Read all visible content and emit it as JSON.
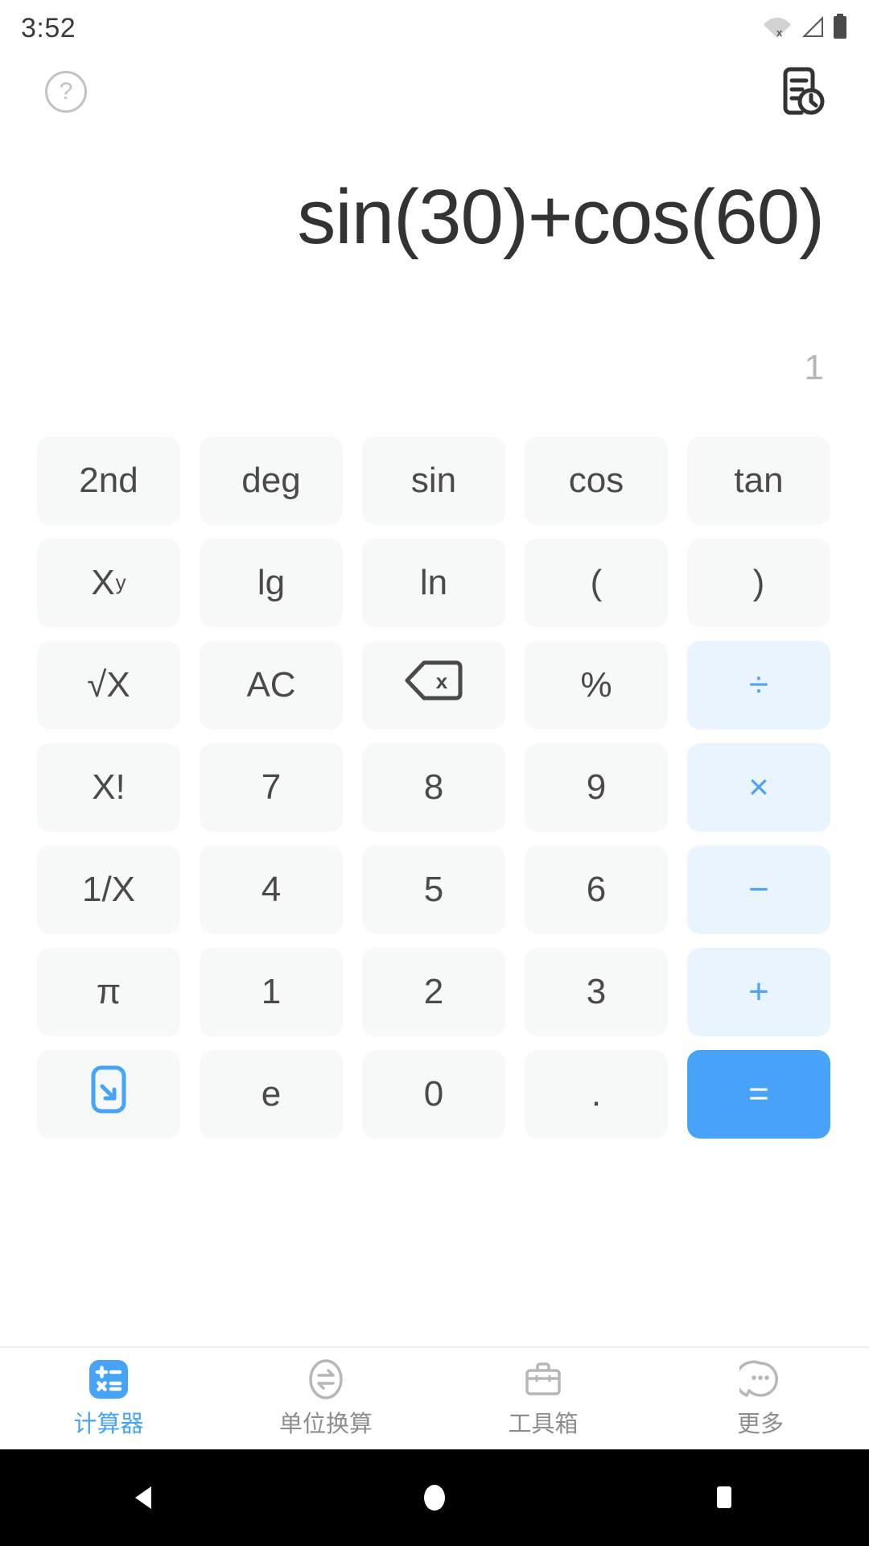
{
  "status_bar": {
    "time": "3:52",
    "icons": [
      "wifi-off-icon",
      "cellular-signal-icon",
      "battery-icon"
    ]
  },
  "top_bar": {
    "help_label": "?",
    "help_icon": "help-circle-icon",
    "history_icon": "history-document-clock-icon"
  },
  "display": {
    "expression": "sin(30)+cos(60)",
    "result": "1"
  },
  "colors": {
    "accent": "#46a3f7",
    "operator_bg": "#eaf4fe",
    "key_bg": "#f7f8f8",
    "key_text": "#4a4a4a",
    "expression_text": "#333333",
    "result_text": "#b6b6b6"
  },
  "keypad": {
    "rows": [
      [
        {
          "label": "2nd",
          "name": "key-2nd",
          "kind": "fn"
        },
        {
          "label": "deg",
          "name": "key-deg",
          "kind": "fn"
        },
        {
          "label": "sin",
          "name": "key-sin",
          "kind": "fn"
        },
        {
          "label": "cos",
          "name": "key-cos",
          "kind": "fn"
        },
        {
          "label": "tan",
          "name": "key-tan",
          "kind": "fn"
        }
      ],
      [
        {
          "label": "X",
          "sup": "y",
          "name": "key-power",
          "kind": "fn"
        },
        {
          "label": "lg",
          "name": "key-lg",
          "kind": "fn"
        },
        {
          "label": "ln",
          "name": "key-ln",
          "kind": "fn"
        },
        {
          "label": "(",
          "name": "key-open-paren",
          "kind": "fn"
        },
        {
          "label": ")",
          "name": "key-close-paren",
          "kind": "fn"
        }
      ],
      [
        {
          "label": "√X",
          "name": "key-sqrt",
          "kind": "fn"
        },
        {
          "label": "AC",
          "name": "key-all-clear",
          "kind": "fn"
        },
        {
          "label": "",
          "icon": "backspace-icon",
          "name": "key-backspace",
          "kind": "fn"
        },
        {
          "label": "%",
          "name": "key-percent",
          "kind": "fn"
        },
        {
          "label": "÷",
          "name": "key-divide",
          "kind": "op"
        }
      ],
      [
        {
          "label": "X!",
          "name": "key-factorial",
          "kind": "fn"
        },
        {
          "label": "7",
          "name": "key-7",
          "kind": "num"
        },
        {
          "label": "8",
          "name": "key-8",
          "kind": "num"
        },
        {
          "label": "9",
          "name": "key-9",
          "kind": "num"
        },
        {
          "label": "×",
          "name": "key-multiply",
          "kind": "op"
        }
      ],
      [
        {
          "label": "1/X",
          "name": "key-reciprocal",
          "kind": "fn"
        },
        {
          "label": "4",
          "name": "key-4",
          "kind": "num"
        },
        {
          "label": "5",
          "name": "key-5",
          "kind": "num"
        },
        {
          "label": "6",
          "name": "key-6",
          "kind": "num"
        },
        {
          "label": "−",
          "name": "key-subtract",
          "kind": "op"
        }
      ],
      [
        {
          "label": "π",
          "name": "key-pi",
          "kind": "fn"
        },
        {
          "label": "1",
          "name": "key-1",
          "kind": "num"
        },
        {
          "label": "2",
          "name": "key-2",
          "kind": "num"
        },
        {
          "label": "3",
          "name": "key-3",
          "kind": "num"
        },
        {
          "label": "+",
          "name": "key-add",
          "kind": "op"
        }
      ],
      [
        {
          "label": "",
          "icon": "collapse-keypad-icon",
          "name": "key-collapse-keypad",
          "kind": "fn"
        },
        {
          "label": "e",
          "name": "key-e",
          "kind": "fn"
        },
        {
          "label": "0",
          "name": "key-0",
          "kind": "num"
        },
        {
          "label": ".",
          "name": "key-decimal-point",
          "kind": "num"
        },
        {
          "label": "=",
          "name": "key-equals",
          "kind": "equals"
        }
      ]
    ]
  },
  "tabs": [
    {
      "label": "计算器",
      "icon": "calculator-icon",
      "name": "tab-calculator",
      "active": true
    },
    {
      "label": "单位换算",
      "icon": "unit-convert-icon",
      "name": "tab-unit-conversion",
      "active": false
    },
    {
      "label": "工具箱",
      "icon": "toolbox-icon",
      "name": "tab-toolbox",
      "active": false
    },
    {
      "label": "更多",
      "icon": "more-bubble-icon",
      "name": "tab-more",
      "active": false
    }
  ],
  "android_nav": {
    "back": "back-triangle-icon",
    "home": "home-circle-icon",
    "recents": "recents-square-icon"
  }
}
